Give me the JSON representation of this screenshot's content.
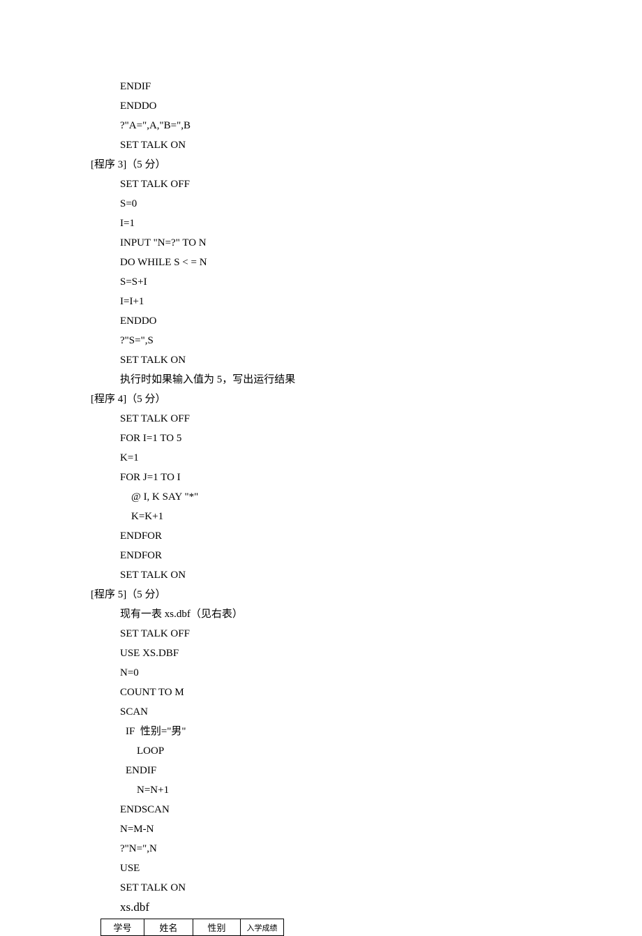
{
  "lines": [
    {
      "cls": "indent1",
      "text": "ENDIF"
    },
    {
      "cls": "indent1",
      "text": "ENDDO"
    },
    {
      "cls": "indent1",
      "text": "?\"A=\",A,\"B=\",B"
    },
    {
      "cls": "indent1",
      "text": "SET TALK ON"
    },
    {
      "cls": "",
      "text": "[程序 3]（5 分）"
    },
    {
      "cls": "indent1",
      "text": "SET TALK OFF"
    },
    {
      "cls": "indent1",
      "text": "S=0"
    },
    {
      "cls": "indent1",
      "text": "I=1"
    },
    {
      "cls": "indent1",
      "text": "INPUT \"N=?\" TO N"
    },
    {
      "cls": "indent1",
      "text": "DO WHILE S < = N"
    },
    {
      "cls": "indent1",
      "text": "S=S+I"
    },
    {
      "cls": "indent1",
      "text": "I=I+1"
    },
    {
      "cls": "indent1",
      "text": "ENDDO"
    },
    {
      "cls": "indent1",
      "text": "?\"S=\",S"
    },
    {
      "cls": "indent1",
      "text": "SET TALK ON"
    },
    {
      "cls": "indent1",
      "text": "执行时如果输入值为 5，写出运行结果"
    },
    {
      "cls": "",
      "text": "[程序 4]（5 分）"
    },
    {
      "cls": "indent1",
      "text": "SET TALK OFF"
    },
    {
      "cls": "indent1",
      "text": "FOR I=1 TO 5"
    },
    {
      "cls": "indent1",
      "text": "K=1"
    },
    {
      "cls": "indent1",
      "text": "FOR J=1 TO I"
    },
    {
      "cls": "indent2",
      "text": "@ I, K SAY \"*\""
    },
    {
      "cls": "indent2",
      "text": "K=K+1"
    },
    {
      "cls": "indent1",
      "text": "ENDFOR"
    },
    {
      "cls": "indent1",
      "text": "ENDFOR"
    },
    {
      "cls": "indent1",
      "text": "SET TALK ON"
    },
    {
      "cls": "",
      "text": "[程序 5]（5 分）"
    },
    {
      "cls": "indent1",
      "text": "现有一表 xs.dbf（见右表）"
    },
    {
      "cls": "indent1",
      "text": "SET TALK OFF"
    },
    {
      "cls": "indent1",
      "text": "USE XS.DBF"
    },
    {
      "cls": "indent1",
      "text": "N=0"
    },
    {
      "cls": "indent1",
      "text": "COUNT TO M"
    },
    {
      "cls": "indent1",
      "text": "SCAN"
    },
    {
      "cls": "indent15",
      "text": "IF  性别=\"男\""
    },
    {
      "cls": "indent3",
      "text": "LOOP"
    },
    {
      "cls": "indent15",
      "text": "ENDIF"
    },
    {
      "cls": "indent3",
      "text": "N=N+1"
    },
    {
      "cls": "indent1",
      "text": "ENDSCAN"
    },
    {
      "cls": "indent1",
      "text": "N=M-N"
    },
    {
      "cls": "indent1",
      "text": "?\"N=\",N"
    },
    {
      "cls": "indent1",
      "text": "USE"
    },
    {
      "cls": "indent1",
      "text": "SET TALK ON"
    }
  ],
  "xsdbf_label": "xs.dbf",
  "table": {
    "headers": [
      "学号",
      "姓名",
      "性别",
      "入学成绩"
    ]
  }
}
